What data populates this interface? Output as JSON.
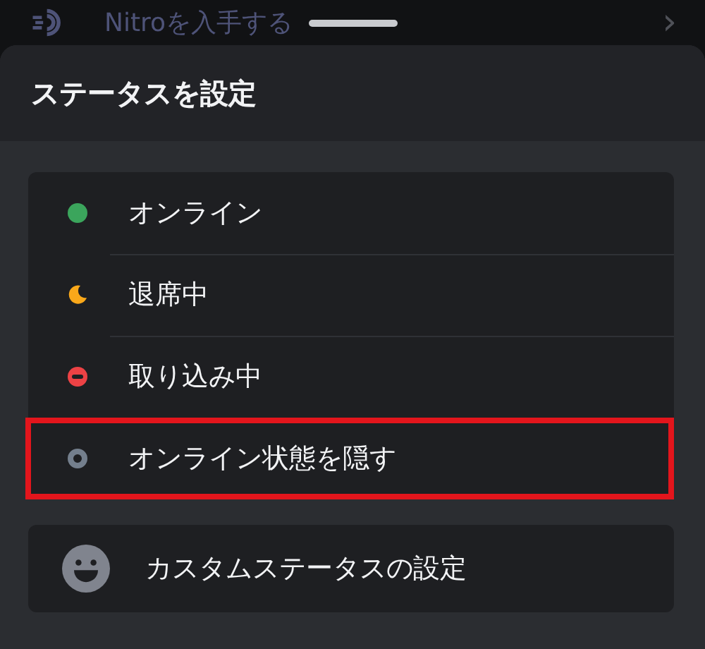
{
  "background_item": {
    "label": "Nitroを入手する",
    "chevron": "›"
  },
  "sheet": {
    "title": "ステータスを設定"
  },
  "statuses": [
    {
      "kind": "online",
      "label": "オンライン",
      "color": "#3ba55c",
      "highlighted": false
    },
    {
      "kind": "idle",
      "label": "退席中",
      "color": "#faa81a",
      "highlighted": false
    },
    {
      "kind": "dnd",
      "label": "取り込み中",
      "color": "#ed4245",
      "highlighted": false
    },
    {
      "kind": "invisible",
      "label": "オンライン状態を隠す",
      "color": "#747f8d",
      "highlighted": true
    }
  ],
  "custom_status": {
    "label": "カスタムステータスの設定"
  }
}
